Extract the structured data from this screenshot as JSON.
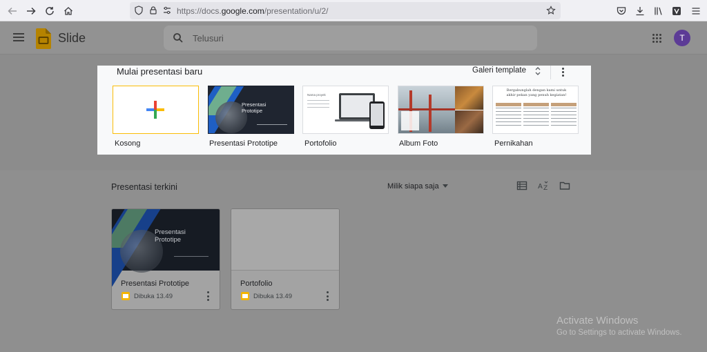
{
  "browser": {
    "url_prefix": "https://docs.",
    "url_domain": "google.com",
    "url_path": "/presentation/u/2/"
  },
  "app": {
    "title": "Slide",
    "search_placeholder": "Telusuri",
    "avatar_letter": "T",
    "brand_color": "#f4b400",
    "avatar_color": "#5c3b96"
  },
  "templates": {
    "heading": "Mulai presentasi baru",
    "gallery_label": "Galeri template",
    "items": [
      {
        "label": "Kosong"
      },
      {
        "label": "Presentasi Prototipe",
        "thumb_title": "Presentasi Prototipe"
      },
      {
        "label": "Portofolio",
        "thumb_title": "Nama proyek"
      },
      {
        "label": "Album Foto"
      },
      {
        "label": "Pernikahan",
        "thumb_title": "Bergabunglah dengan kami untuk akhir pekan yang penuh kegiatan!"
      }
    ]
  },
  "recent": {
    "title": "Presentasi terkini",
    "owner_filter": "Milik siapa saja",
    "docs": [
      {
        "name": "Presentasi Prototipe",
        "opened": "Dibuka 13.49",
        "thumb_title": "Presentasi Prototipe"
      },
      {
        "name": "Portofolio",
        "opened": "Dibuka 13.49"
      }
    ]
  },
  "watermark": {
    "line1": "Activate Windows",
    "line2": "Go to Settings to activate Windows."
  }
}
